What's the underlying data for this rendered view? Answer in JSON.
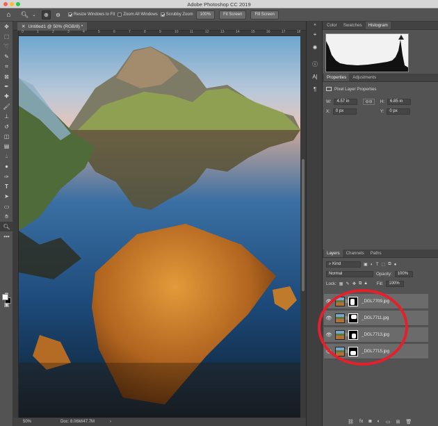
{
  "app": {
    "title": "Adobe Photoshop CC 2019"
  },
  "options_bar": {
    "zoom_in_icon": "zoom-in-icon",
    "resize_windows_label": "Resize Windows to Fit",
    "zoom_all_windows_label": "Zoom All Windows",
    "scrubby_zoom_label": "Scrubby Zoom",
    "zoom_percent_button": "100%",
    "fit_screen_button": "Fit Screen",
    "fill_screen_button": "Fill Screen",
    "resize_windows_checked": true,
    "zoom_all_windows_checked": false,
    "scrubby_zoom_checked": true
  },
  "document": {
    "tab_title": "Untitled1 @ 50% (RGB/8) *",
    "ruler_ticks": [
      "0",
      "1",
      "2",
      "3",
      "4",
      "5",
      "6",
      "7",
      "8",
      "9",
      "10",
      "11",
      "12",
      "13",
      "14",
      "15",
      "16",
      "17",
      "18"
    ]
  },
  "status": {
    "zoom": "50%",
    "doc_size": "Doc: 8.06M/47.7M"
  },
  "histogram_panel": {
    "tabs": [
      "Color",
      "Swatches",
      "Histogram"
    ],
    "active_tab": "Histogram"
  },
  "properties_panel": {
    "tabs": [
      "Properties",
      "Adjustments"
    ],
    "active_tab": "Properties",
    "kind_label": "Pixel Layer Properties",
    "w_label": "W:",
    "w_value": "4.57 in",
    "h_label": "H:",
    "h_value": "6.85 in",
    "x_label": "X:",
    "x_value": "0 px",
    "y_label": "Y:",
    "y_value": "0 px"
  },
  "layers_panel": {
    "tabs": [
      "Layers",
      "Channels",
      "Paths"
    ],
    "active_tab": "Layers",
    "filter_kind": "Kind",
    "blend_mode": "Normal",
    "opacity_label": "Opacity:",
    "opacity_value": "100%",
    "lock_label": "Lock:",
    "fill_label": "Fill:",
    "fill_value": "100%",
    "layers": [
      {
        "name": "_DGL7709.jpg",
        "visible": true
      },
      {
        "name": "_DGL7711.jpg",
        "visible": true
      },
      {
        "name": "_DGL7713.jpg",
        "visible": true
      },
      {
        "name": "_DGL7715.jpg",
        "visible": true
      }
    ]
  },
  "annotation": {
    "color": "#e4202b"
  }
}
